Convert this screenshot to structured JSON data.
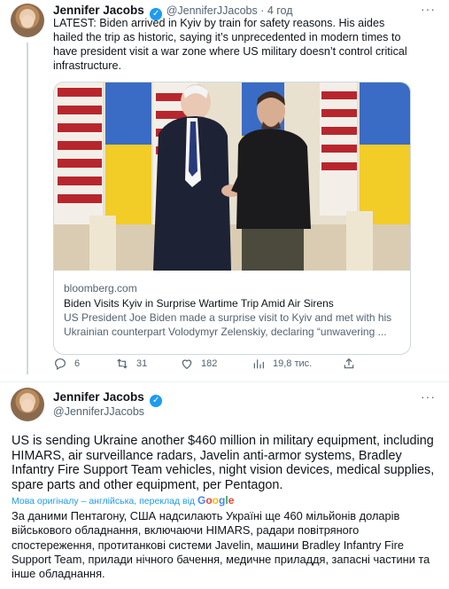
{
  "tweet1": {
    "author_name": "Jennifer Jacobs",
    "handle_time": "@JenniferJJacobs · 4 год",
    "text": "LATEST: Biden arrived in Kyiv by train for safety reasons. His aides hailed the trip as historic, saying it’s unprecedented in modern times to have president visit a war zone where US military doesn’t control critical infrastructure.",
    "card": {
      "domain": "bloomberg.com",
      "title": "Biden Visits Kyiv in Surprise Wartime Trip Amid Air Sirens",
      "description": "US President Joe Biden made a surprise visit to Kyiv and met with his Ukrainian counterpart Volodymyr Zelenskiy, declaring “unwavering ..."
    },
    "actions": {
      "replies": "6",
      "retweets": "31",
      "likes": "182",
      "views": "19,8 тис."
    }
  },
  "tweet2": {
    "author_name": "Jennifer Jacobs",
    "handle": "@JenniferJJacobs",
    "text": "US is sending Ukraine another $460 million in military equipment, including HIMARS, air surveillance radars, Javelin anti-armor systems, Bradley Infantry Fire Support Team vehicles, night vision devices, medical supplies, spare parts and other equipment, per Pentagon.",
    "translate_note": "Мова оригіналу – англійська, переклад від",
    "translate_brand": "Google",
    "translation": "За даними Пентагону, США надсилають Україні ще 460 мільйонів доларів військового обладнання, включаючи HIMARS, радари повітряного спостереження, протитанкові системи Javelin, машини Bradley Infantry Fire Support Team, прилади нічного бачення, медичне приладдя, запасні частини та інше обладнання."
  },
  "colors": {
    "accent": "#1d9bf0",
    "secondary_text": "#536471",
    "border": "#cfd9de"
  }
}
